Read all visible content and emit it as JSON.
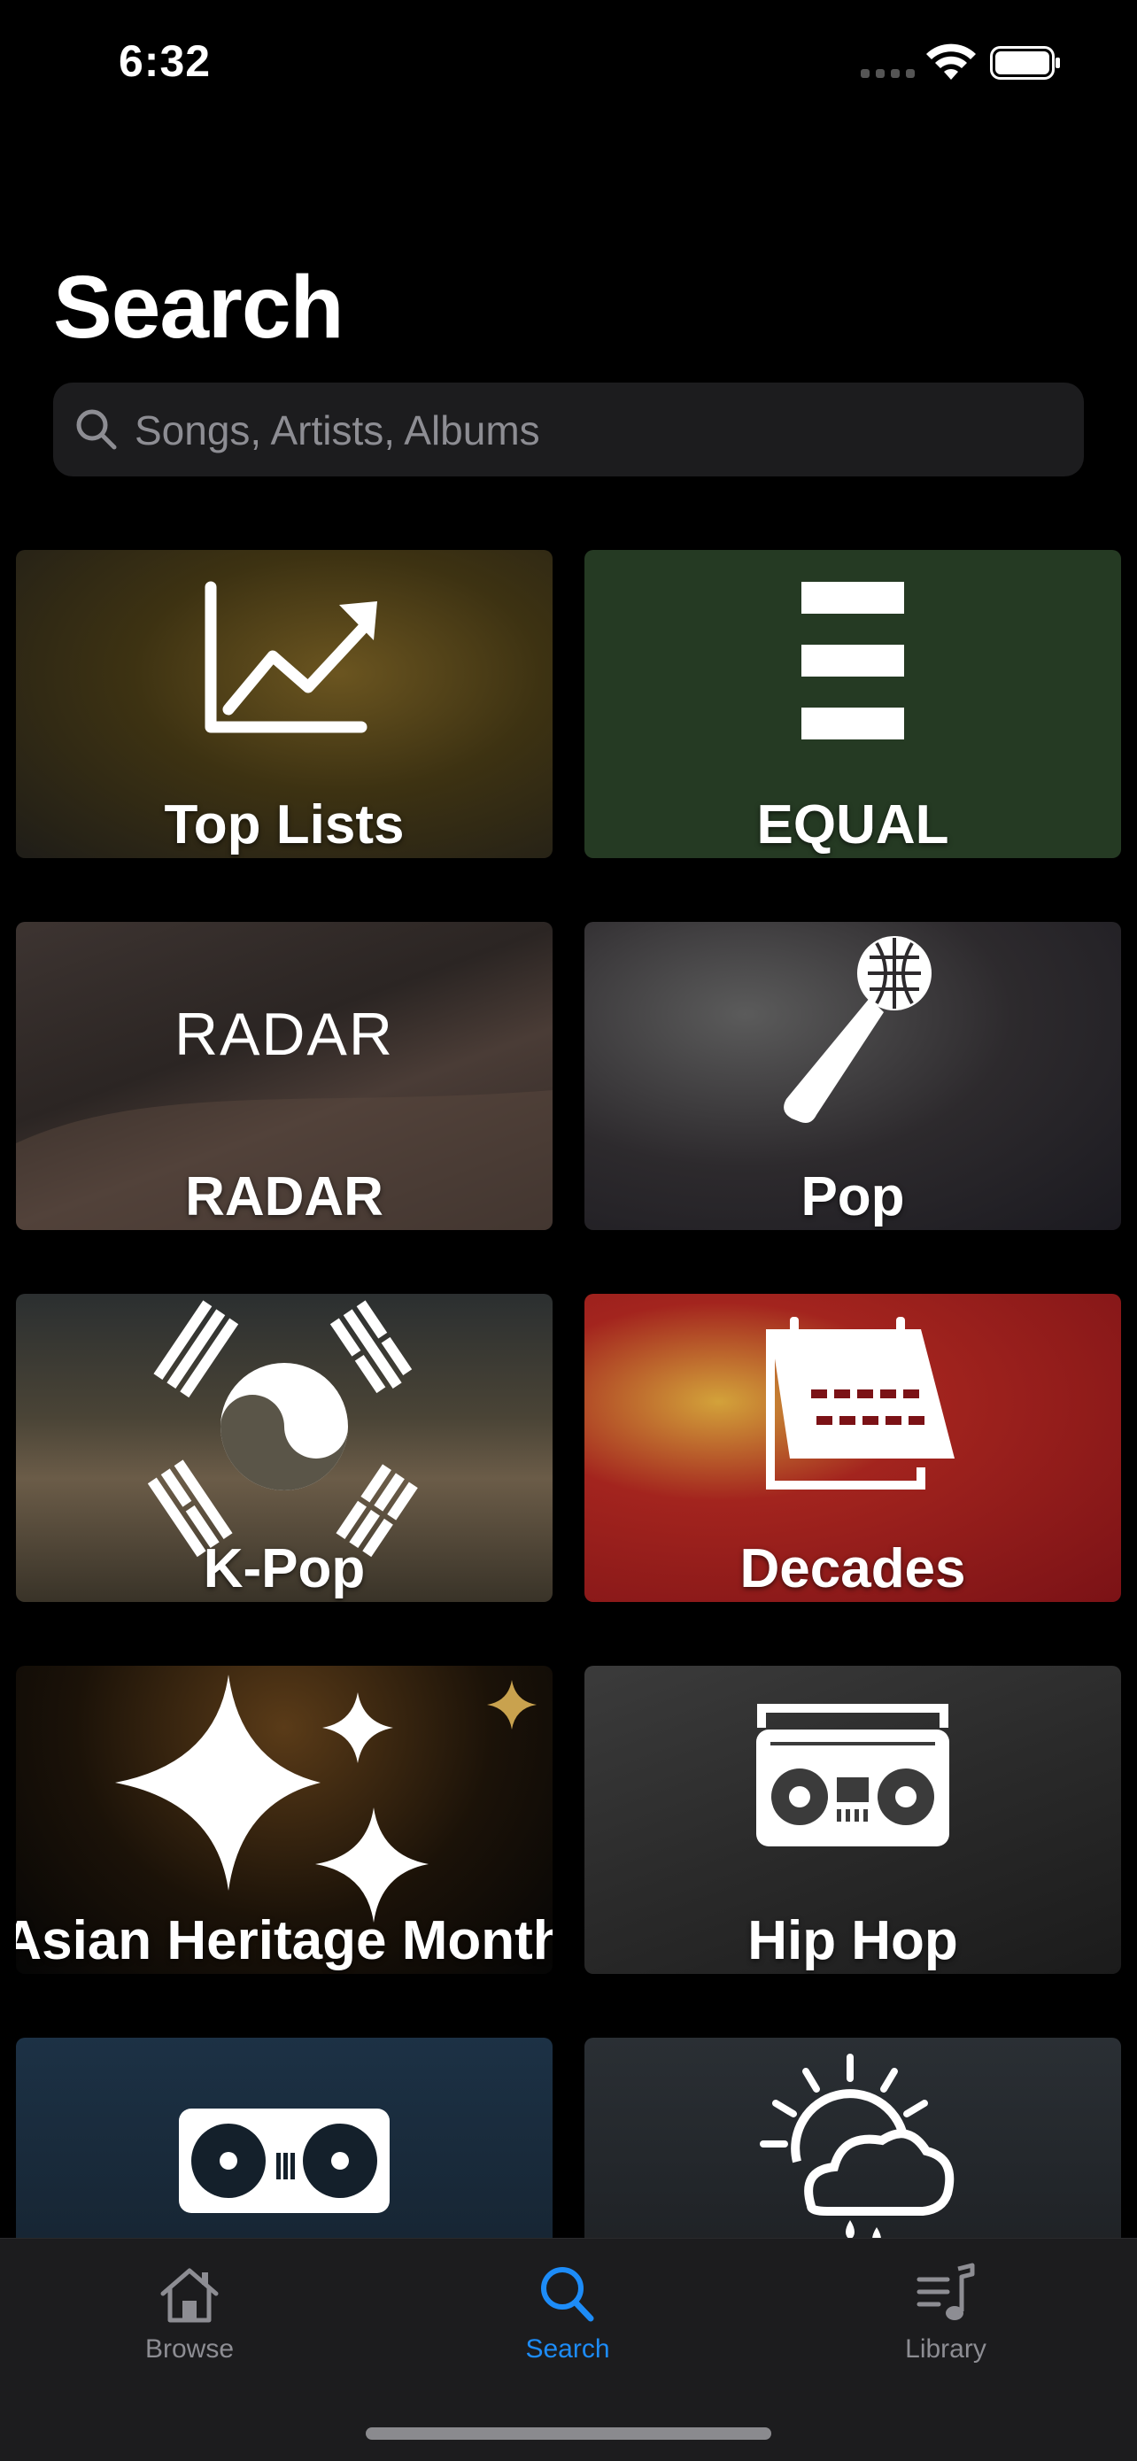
{
  "status_bar": {
    "time": "6:32"
  },
  "header": {
    "title": "Search"
  },
  "search": {
    "placeholder": "Songs, Artists, Albums",
    "value": ""
  },
  "categories": [
    {
      "label": "Top Lists",
      "icon": "chart-trend-icon"
    },
    {
      "label": "EQUAL",
      "icon": "equal-bars-icon"
    },
    {
      "label": "RADAR",
      "icon": "radar-wordmark",
      "art_text": "RADAR"
    },
    {
      "label": "Pop",
      "icon": "microphone-icon"
    },
    {
      "label": "K-Pop",
      "icon": "korean-flag-icon"
    },
    {
      "label": "Decades",
      "icon": "calendar-icon"
    },
    {
      "label": "Asian Heritage Month",
      "icon": "sparkles-icon"
    },
    {
      "label": "Hip Hop",
      "icon": "boombox-icon"
    },
    {
      "label": "",
      "icon": "turntables-icon"
    },
    {
      "label": "",
      "icon": "weather-icon"
    }
  ],
  "tab_bar": {
    "tabs": [
      {
        "label": "Browse",
        "icon": "house-icon",
        "active": false
      },
      {
        "label": "Search",
        "icon": "search-icon",
        "active": true
      },
      {
        "label": "Library",
        "icon": "music-library-icon",
        "active": false
      }
    ],
    "active_color": "#1d8cf8",
    "inactive_color": "#8d8d93"
  }
}
